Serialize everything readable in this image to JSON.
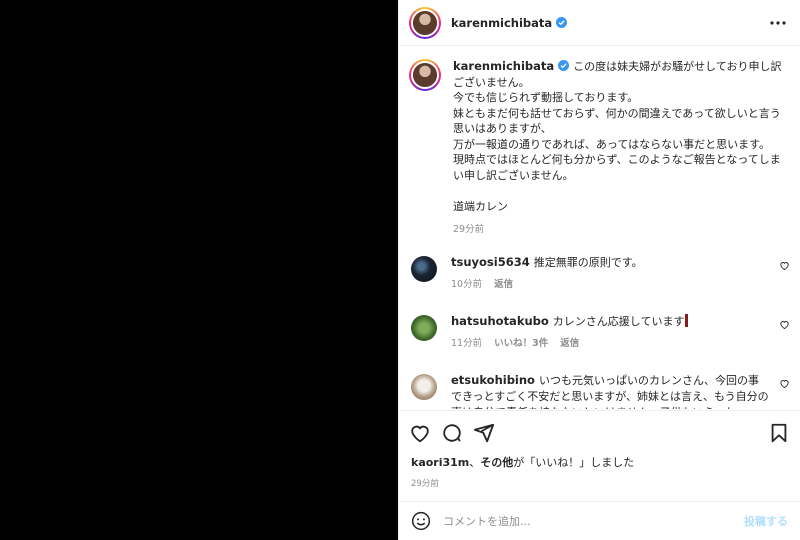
{
  "colors": {
    "link_blue": "#0095f6",
    "verified_blue": "#3897f0",
    "muted_gray": "#8e8e8e",
    "post_button_disabled": "#b2dffc"
  },
  "post": {
    "username": "karenmichibata",
    "verified": true
  },
  "caption": {
    "username": "karenmichibata",
    "text": "この度は妹夫婦がお騒がせしており申し訳ございません。\n今でも信じられず動揺しております。\n妹ともまだ何も話せておらず、何かの間違えであって欲しいと言う思いはありますが、\n万が一報道の通りであれば、あってはならない事だと思います。\n現時点ではほとんど何も分からず、このようなご報告となってしまい申し訳ございません。\n\n道端カレン",
    "time": "29分前"
  },
  "comments": [
    {
      "username": "tsuyosi5634",
      "text": "推定無罪の原則です。",
      "time": "10分前",
      "reply_label": "返信",
      "likes_label": ""
    },
    {
      "username": "hatsuhotakubo",
      "text": "カレンさん応援しています",
      "time": "11分前",
      "likes_label": "いいね！3件",
      "reply_label": "返信"
    },
    {
      "username": "etsukohibino",
      "text": "いつも元気いっぱいのカレンさん、今回の事できっとすごく不安だと思いますが、姉妹とは言え、もう自分の事は自分で責任を持たないといけません。子供もいらっし",
      "time": "",
      "likes_label": "",
      "reply_label": ""
    }
  ],
  "likes": {
    "user": "kaori31m",
    "separator": "、",
    "others": "その他",
    "suffix": "が「いいね！」しました"
  },
  "footer_time": "29分前",
  "comment_box": {
    "placeholder": "コメントを追加...",
    "post_label": "投稿する"
  },
  "icons": {
    "more": "more-horizontal-icon",
    "like": "heart-icon",
    "comment": "comment-icon",
    "share": "share-icon",
    "save": "bookmark-icon",
    "emoji": "emoji-icon"
  }
}
